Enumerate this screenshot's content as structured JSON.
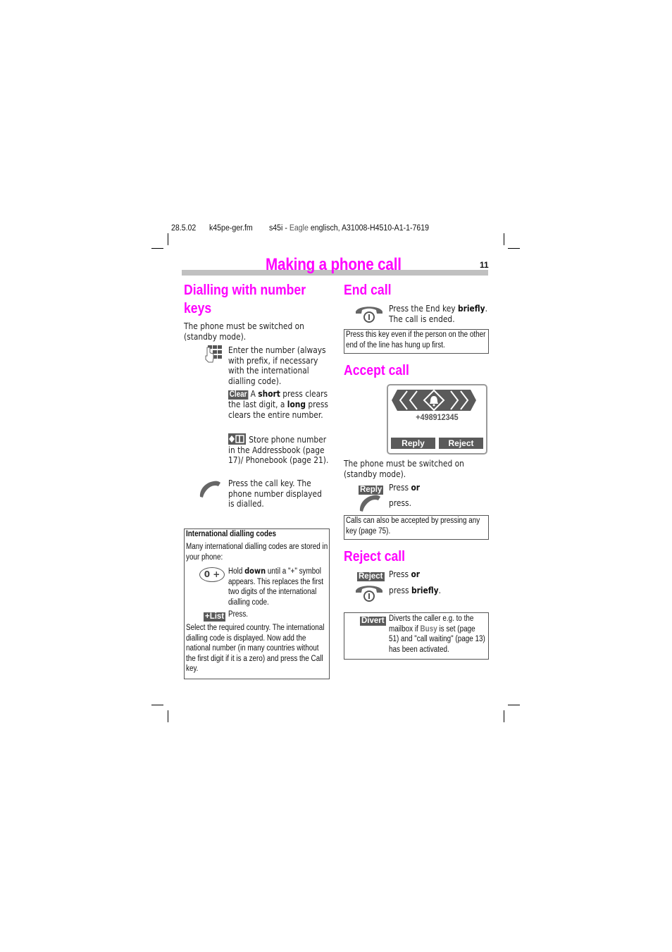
{
  "header": {
    "date": "28.5.02",
    "filename": "k45pe-ger.fm",
    "model": "s45i - ",
    "codename": "Eagle",
    "docref": "englisch, A31008-H4510-A1-1-7619"
  },
  "page": {
    "title": "Making a phone call",
    "number": "11",
    "accent_color": "#ff00ff",
    "bar_color": "#c0c0c0"
  },
  "dialling": {
    "heading_line1": "Dialling with number",
    "heading_line2": "keys",
    "intro": "The phone must be switched on (standby mode).",
    "steps": [
      {
        "icon": "keypad-icon",
        "text": "Enter the number (always with prefix, if necessary with the international dialling code)."
      },
      {
        "key": "Clear",
        "text_pre": "A ",
        "bold1": "short",
        "text_mid": " press clears the last digit, a ",
        "bold2": "long",
        "text_post": " press clears the entire number."
      },
      {
        "icon": "store-addressbook-icon",
        "text": "Store phone number in the Addressbook (page 17)/ Phonebook (page 21)."
      },
      {
        "icon": "call-key-icon",
        "text": "Press the call key. The phone number displayed is dialled."
      }
    ]
  },
  "intl_box": {
    "title": "International dialling codes",
    "intro": "Many international dialling codes are stored in your phone:",
    "key_zero_plus": "0 +",
    "hold_pre": "Hold ",
    "hold_bold": "down",
    "hold_post": " until a \"+\" symbol appears. This replaces the first two digits of the international dialling code.",
    "list_key": "+List",
    "list_text": "Press.",
    "outro": "Select the required country. The international dialling code is displayed. Now add the national number (in many countries without the first digit if it is a zero) and press the Call key."
  },
  "end_call": {
    "heading": "End call",
    "text_pre": "Press the End key ",
    "text_bold": "briefly",
    "text_post": ". The call is ended.",
    "note": "Press this key even if the person on the other end of the line has hung up first."
  },
  "accept_call": {
    "heading": "Accept call",
    "screen": {
      "number": "+498912345",
      "left_softkey": "Reply",
      "right_softkey": "Reject"
    },
    "intro": "The phone must be switched on (standby mode).",
    "reply_key": "Reply",
    "press_or_pre": "Press ",
    "or": "or",
    "press": "press.",
    "note": "Calls can also be accepted by pressing any key (page 75)."
  },
  "reject_call": {
    "heading": "Reject call",
    "reject_key": "Reject",
    "press_or_pre": "Press ",
    "or": "or",
    "press_pre": "press ",
    "press_bold": "briefly",
    "press_post": ".",
    "divert_key": "Divert",
    "divert_text_pre": "Diverts the caller e.g. to the mailbox if ",
    "divert_busy": "Busy",
    "divert_text_post": " is set (page 51) and \"call waiting\" (page 13) has been activated."
  }
}
